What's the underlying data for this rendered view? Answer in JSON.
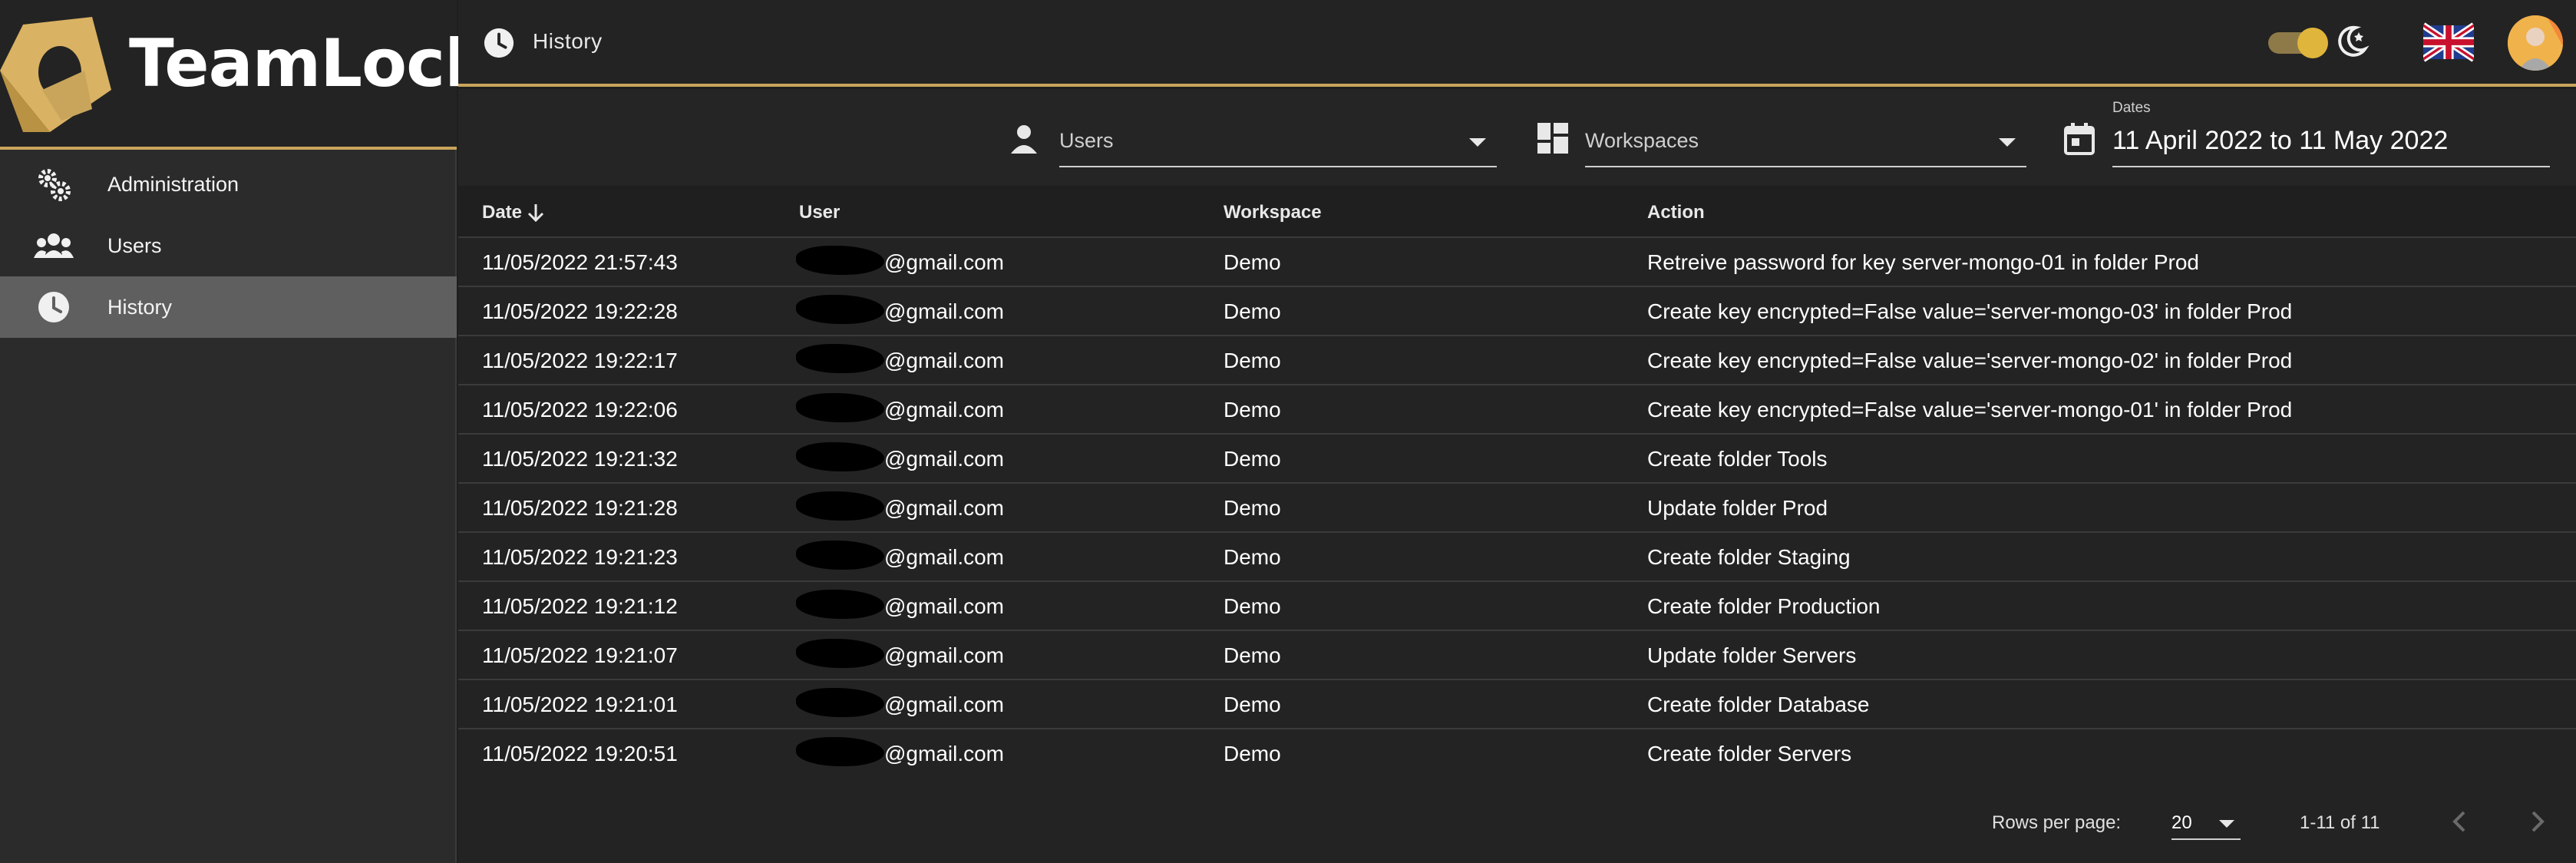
{
  "app": {
    "name": "TeamLock",
    "accent": "#c9a55b"
  },
  "sidebar": {
    "items": [
      {
        "label": "Administration",
        "icon": "gears-icon",
        "active": false
      },
      {
        "label": "Users",
        "icon": "users-icon",
        "active": false
      },
      {
        "label": "History",
        "icon": "clock-icon",
        "active": true
      }
    ]
  },
  "header": {
    "title": "History",
    "theme_toggle": "on",
    "language_flag": "uk-flag-icon"
  },
  "filters": {
    "users_placeholder": "Users",
    "workspaces_placeholder": "Workspaces",
    "dates_label": "Dates",
    "dates_value": "11 April 2022 to 11 May 2022"
  },
  "table": {
    "columns": [
      "Date",
      "User",
      "Workspace",
      "Action"
    ],
    "sort_column": "Date",
    "sort_direction": "descending",
    "rows": [
      {
        "date": "11/05/2022 21:57:43",
        "user": "@gmail.com",
        "workspace": "Demo",
        "action": "Retreive password for key server-mongo-01 in folder Prod"
      },
      {
        "date": "11/05/2022 19:22:28",
        "user": "@gmail.com",
        "workspace": "Demo",
        "action": "Create key encrypted=False value='server-mongo-03' in folder Prod"
      },
      {
        "date": "11/05/2022 19:22:17",
        "user": "@gmail.com",
        "workspace": "Demo",
        "action": "Create key encrypted=False value='server-mongo-02' in folder Prod"
      },
      {
        "date": "11/05/2022 19:22:06",
        "user": "@gmail.com",
        "workspace": "Demo",
        "action": "Create key encrypted=False value='server-mongo-01' in folder Prod"
      },
      {
        "date": "11/05/2022 19:21:32",
        "user": "@gmail.com",
        "workspace": "Demo",
        "action": "Create folder Tools"
      },
      {
        "date": "11/05/2022 19:21:28",
        "user": "@gmail.com",
        "workspace": "Demo",
        "action": "Update folder Prod"
      },
      {
        "date": "11/05/2022 19:21:23",
        "user": "@gmail.com",
        "workspace": "Demo",
        "action": "Create folder Staging"
      },
      {
        "date": "11/05/2022 19:21:12",
        "user": "@gmail.com",
        "workspace": "Demo",
        "action": "Create folder Production"
      },
      {
        "date": "11/05/2022 19:21:07",
        "user": "@gmail.com",
        "workspace": "Demo",
        "action": "Update folder Servers"
      },
      {
        "date": "11/05/2022 19:21:01",
        "user": "@gmail.com",
        "workspace": "Demo",
        "action": "Create folder Database"
      },
      {
        "date": "11/05/2022 19:20:51",
        "user": "@gmail.com",
        "workspace": "Demo",
        "action": "Create folder Servers"
      }
    ]
  },
  "pagination": {
    "rows_per_page_label": "Rows per page:",
    "rows_per_page_value": "20",
    "range_text": "1-11 of 11"
  }
}
